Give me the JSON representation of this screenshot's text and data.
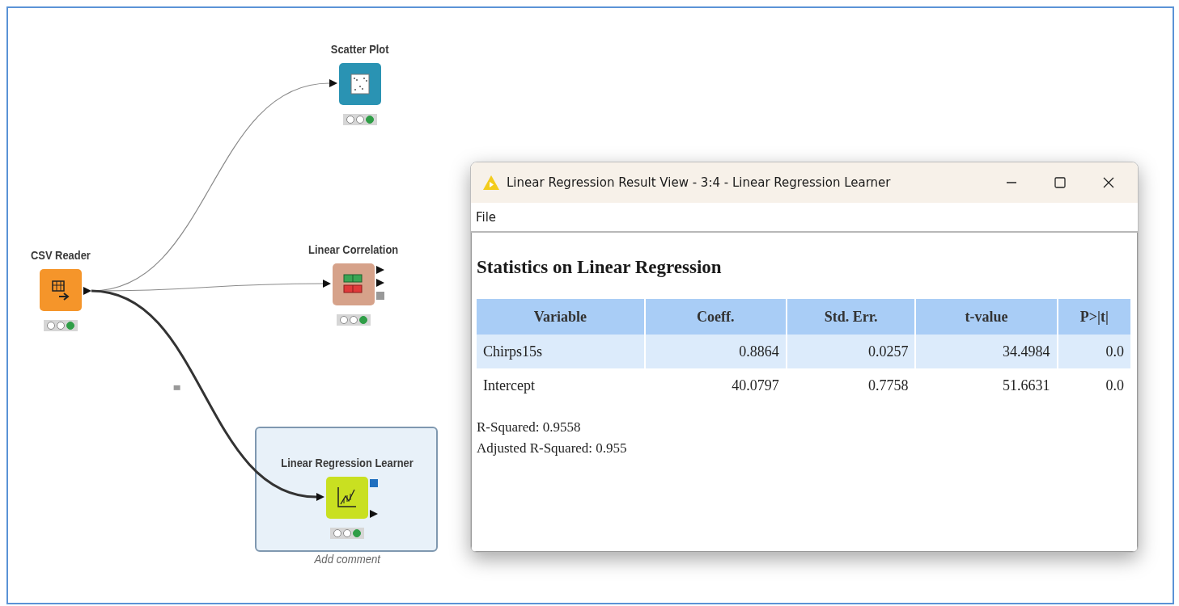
{
  "workflow": {
    "nodes": [
      {
        "label": "CSV Reader",
        "kind": "source",
        "executed": true,
        "selected": false
      },
      {
        "label": "Scatter Plot",
        "kind": "visualizer",
        "executed": true,
        "selected": false
      },
      {
        "label": "Linear Correlation",
        "kind": "statistics",
        "executed": true,
        "selected": false
      },
      {
        "label": "Linear Regression Learner",
        "kind": "learner",
        "executed": true,
        "selected": true,
        "comment_placeholder": "Add comment"
      }
    ]
  },
  "result_window": {
    "title": "Linear Regression Result View - 3:4 - Linear Regression Learner",
    "menu": [
      "File"
    ],
    "heading": "Statistics on Linear Regression",
    "table": {
      "columns": [
        "Variable",
        "Coeff.",
        "Std. Err.",
        "t-value",
        "P>|t|"
      ],
      "rows": [
        [
          "Chirps15s",
          "0.8864",
          "0.0257",
          "34.4984",
          "0.0"
        ],
        [
          "Intercept",
          "40.0797",
          "0.7758",
          "51.6631",
          "0.0"
        ]
      ]
    },
    "statistics": [
      "R-Squared: 0.9558",
      "Adjusted R-Squared: 0.955"
    ]
  }
}
